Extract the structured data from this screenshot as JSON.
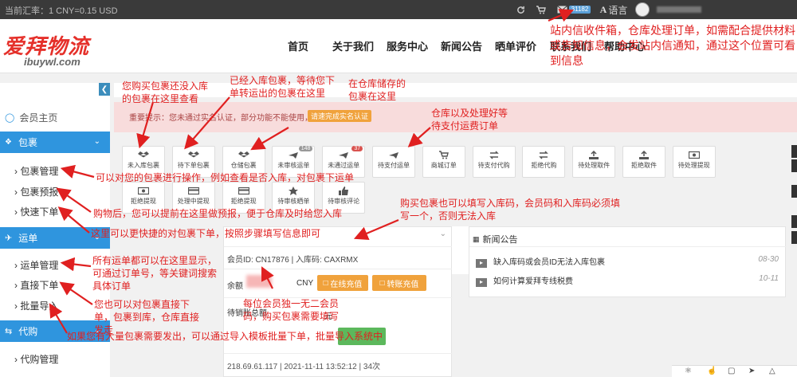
{
  "topbar": {
    "rate": "当前汇率：1 CNY=0.15 USD",
    "mail_count": "31182",
    "lang": "语言"
  },
  "logo": {
    "cn": "爱拜物流",
    "en": "ibuywl.com"
  },
  "nav": [
    "首页",
    "关于我们",
    "服务中心",
    "新闻公告",
    "晒单评价",
    "联系我们",
    "帮助中心"
  ],
  "sidebar": {
    "home": "会员主页",
    "sections": [
      {
        "label": "包裹",
        "items": [
          "包裹管理",
          "包裹预报",
          "快速下单"
        ]
      },
      {
        "label": "运单",
        "items": [
          "运单管理",
          "直接下单",
          "批量导入"
        ]
      },
      {
        "label": "代购",
        "items": [
          "代购管理"
        ]
      }
    ]
  },
  "alert": {
    "text": "重要提示：您未通过实名认证，部分功能不能使用，",
    "button": "请速完成实名认证"
  },
  "quick": {
    "row1": [
      {
        "label": "未入库包裹",
        "icon": "dropbox-icon"
      },
      {
        "label": "待下单包裹",
        "icon": "dropbox-icon"
      },
      {
        "label": "仓储包裹",
        "icon": "dropbox-icon"
      },
      {
        "label": "未审核运单",
        "icon": "plane-icon",
        "count": "148"
      },
      {
        "label": "未通过运单",
        "icon": "plane-icon",
        "count": "37"
      },
      {
        "label": "待支付运单",
        "icon": "plane-icon"
      },
      {
        "label": "商城订单",
        "icon": "cart-icon"
      },
      {
        "label": "待支付代购",
        "icon": "exchange-icon"
      },
      {
        "label": "拒绝代购",
        "icon": "exchange-icon"
      },
      {
        "label": "待处理取件",
        "icon": "upload-icon"
      },
      {
        "label": "拒绝取件",
        "icon": "upload-icon"
      },
      {
        "label": "待处理提现",
        "icon": "money-icon"
      }
    ],
    "row2": [
      {
        "label": "拒绝提现",
        "icon": "money-icon"
      },
      {
        "label": "处理中提现",
        "icon": "card-icon"
      },
      {
        "label": "拒绝提现",
        "icon": "card-icon"
      },
      {
        "label": "待审核晒单",
        "icon": "star-icon"
      },
      {
        "label": "待审核评论",
        "icon": "thumbs-icon"
      }
    ]
  },
  "account": {
    "member_id": "会员ID: CN17876",
    "warehouse_code": "入库码: CAXRMX",
    "balance_label": "余额",
    "currency": "CNY",
    "recharge": "在线充值",
    "transfer": "转账充值",
    "pending_label": "待销账总额",
    "pending_value": "元",
    "last_login": "218.69.61.117 | 2021-11-11 13:52:12 | 34次"
  },
  "news": {
    "title": "新闻公告",
    "items": [
      {
        "title": "缺入库码或会员ID无法入库包裹",
        "date": "08-30"
      },
      {
        "title": "如何计算爱拜专线税费",
        "date": "10-11"
      }
    ]
  },
  "annotations": [
    "站内信收件箱，仓库处理订单，如需配合提供材料或告知信息，会发站内信通知，通过这个位置可看到信息",
    "您购买包裹还没入库的包裹在这里查看",
    "已经入库包裹，等待您下单转运出的包裹在这里",
    "在仓库储存的包裹在这里",
    "仓库以及处理好等待支付运费订单",
    "可以对您的包裹进行操作，例如查看是否入库，对包裹下运单",
    "购物后，您可以提前在这里做预报，便于仓库及时给您入库",
    "这里可以更快捷的对包裹下单，按照步骤填写信息即可",
    "购买包裹也可以填写入库码，会员码和入库码必须填写一个，否则无法入库",
    "所有运单都可以在这里显示，可通过订单号，等关键词搜索具体订单",
    "您也可以对包裹直接下单，包裹到库，仓库直接发走",
    "每位会员独一无二会员码，购买包裹需要填写",
    "如果您有大量包裹需要发出，可以通过导入模板批量下单，批量导入系统中"
  ],
  "colors": {
    "topbar": "#3a3a3a",
    "sidebar_active": "#2f95de",
    "annotation": "#e02020",
    "brand": "#e5302a",
    "orange_btn": "#f0a23c"
  }
}
